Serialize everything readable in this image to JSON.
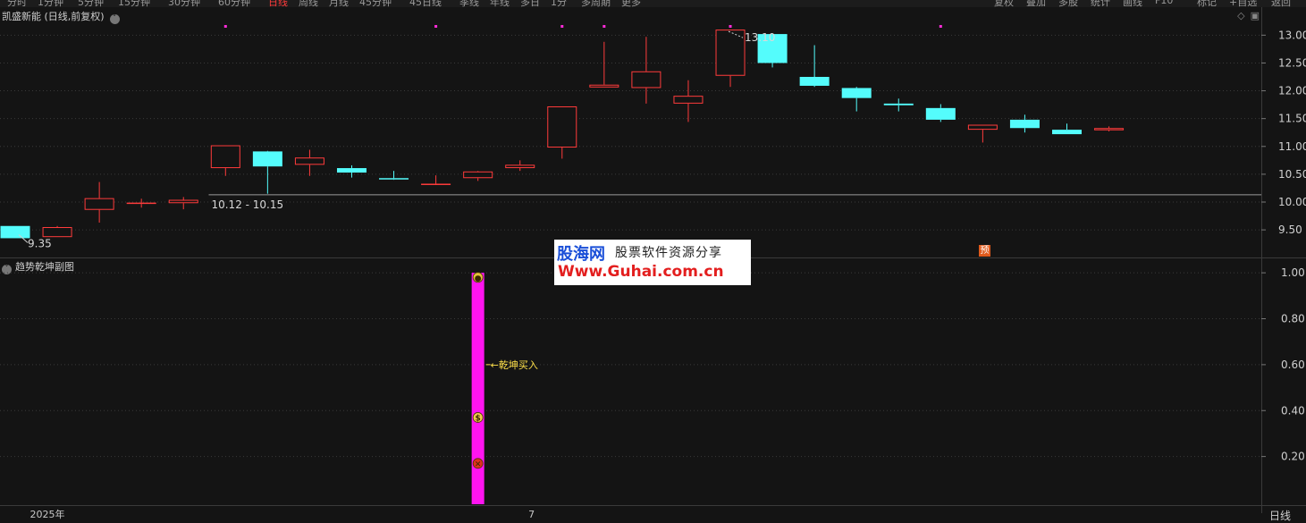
{
  "toolbar": {
    "periods": [
      "分时",
      "1分钟",
      "5分钟",
      "15分钟",
      "30分钟",
      "60分钟",
      "日线",
      "周线",
      "月线",
      "45分钟",
      "45日线",
      "季线",
      "年线",
      "多日",
      "1分",
      "多周期",
      "更多"
    ],
    "active_period": "日线",
    "right_buttons": [
      "复权",
      "叠加",
      "多股",
      "统计",
      "画线",
      "F10",
      "标记",
      "+自选",
      "返回"
    ]
  },
  "chart": {
    "title": "凯盛新能 (日线,前复权)",
    "subchart_title": "趋势乾坤副图",
    "period_label": "日线",
    "support_label": "10.12 - 10.15",
    "low_label": "9.35",
    "high_label": "13.10",
    "signal_label": "乾坤买入",
    "pre_badge": "预"
  },
  "watermark": {
    "brand": "股海网",
    "slogan": "股票软件资源分享",
    "url": "Www.Guhai.com.cn"
  },
  "chart_data": {
    "type": "candlestick",
    "up_color": "#ff3b3b",
    "down_color": "#54fcfc",
    "y_ticks": [
      "9.50",
      "10.00",
      "10.50",
      "11.00",
      "11.50",
      "12.00",
      "12.50",
      "13.00"
    ],
    "y_range": [
      9.1,
      13.15
    ],
    "sub_y_ticks": [
      "0.20",
      "0.40",
      "0.60",
      "0.80",
      "1.00"
    ],
    "sub_y_range": [
      0.0,
      1.02
    ],
    "support_level": 10.13,
    "candles": [
      {
        "o": 9.57,
        "h": 9.57,
        "l": 9.35,
        "c": 9.35
      },
      {
        "o": 9.37,
        "h": 9.57,
        "l": 9.37,
        "c": 9.55
      },
      {
        "o": 9.86,
        "h": 10.36,
        "l": 9.63,
        "c": 10.07
      },
      {
        "o": 9.97,
        "h": 10.06,
        "l": 9.9,
        "c": 9.99
      },
      {
        "o": 9.98,
        "h": 10.09,
        "l": 9.87,
        "c": 10.04
      },
      {
        "o": 10.61,
        "h": 11.02,
        "l": 10.47,
        "c": 11.02
      },
      {
        "o": 10.91,
        "h": 10.92,
        "l": 10.15,
        "c": 10.64
      },
      {
        "o": 10.67,
        "h": 10.94,
        "l": 10.47,
        "c": 10.8
      },
      {
        "o": 10.61,
        "h": 10.66,
        "l": 10.44,
        "c": 10.53
      },
      {
        "o": 10.43,
        "h": 10.56,
        "l": 10.4,
        "c": 10.41
      },
      {
        "o": 10.33,
        "h": 10.48,
        "l": 10.32,
        "c": 10.33
      },
      {
        "o": 10.43,
        "h": 10.56,
        "l": 10.38,
        "c": 10.55
      },
      {
        "o": 10.61,
        "h": 10.75,
        "l": 10.56,
        "c": 10.67
      },
      {
        "o": 10.98,
        "h": 11.72,
        "l": 10.78,
        "c": 11.72
      },
      {
        "o": 12.06,
        "h": 12.88,
        "l": 12.06,
        "c": 12.11
      },
      {
        "o": 12.05,
        "h": 12.97,
        "l": 11.77,
        "c": 12.35
      },
      {
        "o": 11.77,
        "h": 12.19,
        "l": 11.44,
        "c": 11.91
      },
      {
        "o": 12.27,
        "h": 13.1,
        "l": 12.07,
        "c": 13.1
      },
      {
        "o": 13.02,
        "h": 13.02,
        "l": 12.42,
        "c": 12.5
      },
      {
        "o": 12.25,
        "h": 12.82,
        "l": 12.07,
        "c": 12.09
      },
      {
        "o": 12.05,
        "h": 12.07,
        "l": 11.63,
        "c": 11.87
      },
      {
        "o": 11.77,
        "h": 11.86,
        "l": 11.63,
        "c": 11.74
      },
      {
        "o": 11.69,
        "h": 11.76,
        "l": 11.44,
        "c": 11.48
      },
      {
        "o": 11.3,
        "h": 11.39,
        "l": 11.07,
        "c": 11.39
      },
      {
        "o": 11.48,
        "h": 11.57,
        "l": 11.25,
        "c": 11.33
      },
      {
        "o": 11.3,
        "h": 11.41,
        "l": 11.22,
        "c": 11.22
      },
      {
        "o": 11.29,
        "h": 11.36,
        "l": 11.27,
        "c": 11.33
      }
    ],
    "signal_candle_index": 11,
    "signal_value": 1.0,
    "signal_icons": [
      {
        "name": "coins-icon",
        "value": 0.98
      },
      {
        "name": "money-bag-icon",
        "value": 0.37
      },
      {
        "name": "butterfly-icon",
        "value": 0.17
      }
    ],
    "marker_dot_candles": [
      5,
      10,
      13,
      14,
      17,
      22
    ],
    "date_labels": [
      {
        "text": "2025年",
        "candle": 0.35
      },
      {
        "text": "7",
        "candle": 12.2
      }
    ]
  }
}
